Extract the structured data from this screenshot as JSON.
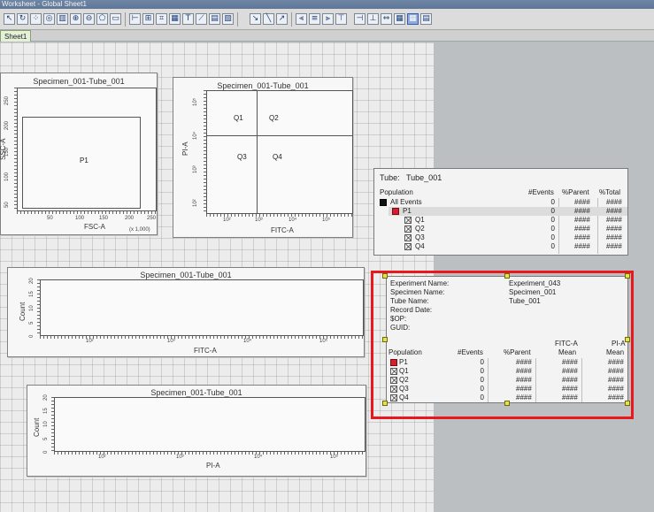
{
  "window": {
    "title": "Worksheet - Global Sheet1"
  },
  "tabs": [
    {
      "label": "Sheet1"
    }
  ],
  "panels": {
    "dot1": {
      "title": "Specimen_001-Tube_001",
      "xlabel": "FSC-A",
      "ylabel": "SSC-A",
      "x_ticks": [
        "50",
        "100",
        "150",
        "200",
        "250"
      ],
      "x_scale": "(x 1,000)",
      "y_ticks": [
        "50",
        "100",
        "150",
        "200",
        "250"
      ],
      "gate": "P1"
    },
    "dot2": {
      "title": "Specimen_001-Tube_001",
      "xlabel": "FITC-A",
      "ylabel": "PI-A",
      "x_ticks": [
        "10²",
        "10³",
        "10⁴",
        "10⁵"
      ],
      "y_ticks": [
        "10²",
        "10³",
        "10⁴",
        "10⁵"
      ],
      "quadrants": [
        "Q1",
        "Q2",
        "Q3",
        "Q4"
      ]
    },
    "hist1": {
      "title": "Specimen_001-Tube_001",
      "xlabel": "FITC-A",
      "ylabel": "Count",
      "x_ticks": [
        "10²",
        "10³",
        "10⁴",
        "10⁵"
      ],
      "y_ticks": [
        "0",
        "5",
        "10",
        "15",
        "20"
      ]
    },
    "hist2": {
      "title": "Specimen_001-Tube_001",
      "xlabel": "PI-A",
      "ylabel": "Count",
      "x_ticks": [
        "10²",
        "10³",
        "10⁴",
        "10⁵"
      ],
      "y_ticks": [
        "0",
        "5",
        "10",
        "15",
        "20"
      ]
    }
  },
  "hierarchy": {
    "tube_label": "Tube:",
    "tube_value": "Tube_001",
    "headers": {
      "population": "Population",
      "events": "#Events",
      "parent": "%Parent",
      "total": "%Total"
    },
    "rows": [
      {
        "name": "All Events",
        "events": "0",
        "parent": "####",
        "total": "####"
      },
      {
        "name": "P1",
        "events": "0",
        "parent": "####",
        "total": "####"
      },
      {
        "name": "Q1",
        "events": "0",
        "parent": "####",
        "total": "####"
      },
      {
        "name": "Q2",
        "events": "0",
        "parent": "####",
        "total": "####"
      },
      {
        "name": "Q3",
        "events": "0",
        "parent": "####",
        "total": "####"
      },
      {
        "name": "Q4",
        "events": "0",
        "parent": "####",
        "total": "####"
      }
    ]
  },
  "statistics": {
    "info": [
      {
        "label": "Experiment Name:",
        "value": "Experiment_043"
      },
      {
        "label": "Specimen Name:",
        "value": "Specimen_001"
      },
      {
        "label": "Tube Name:",
        "value": "Tube_001"
      },
      {
        "label": "Record Date:",
        "value": ""
      },
      {
        "label": "$OP:",
        "value": ""
      },
      {
        "label": "GUID:",
        "value": ""
      }
    ],
    "headers": {
      "population": "Population",
      "events": "#Events",
      "parent": "%Parent",
      "fitc_1": "FITC-A",
      "fitc_2": "Mean",
      "pi_1": "PI-A",
      "pi_2": "Mean"
    },
    "rows": [
      {
        "name": "P1",
        "events": "0",
        "parent": "####",
        "fitc": "####",
        "pi": "####"
      },
      {
        "name": "Q1",
        "events": "0",
        "parent": "####",
        "fitc": "####",
        "pi": "####"
      },
      {
        "name": "Q2",
        "events": "0",
        "parent": "####",
        "fitc": "####",
        "pi": "####"
      },
      {
        "name": "Q3",
        "events": "0",
        "parent": "####",
        "fitc": "####",
        "pi": "####"
      },
      {
        "name": "Q4",
        "events": "0",
        "parent": "####",
        "fitc": "####",
        "pi": "####"
      }
    ]
  },
  "colors": {
    "highlight": "#e8181c",
    "p1": "#d4202e",
    "all_events": "#111111",
    "selection_handle": "#e8e24a"
  },
  "toolbar_icons": [
    "pointer-icon",
    "rotate-icon",
    "dot-plot-icon",
    "contour-plot-icon",
    "histogram-icon",
    "zoom-in-icon",
    "zoom-out-icon",
    "polygon-gate-icon",
    "rectangle-gate-icon",
    "interval-gate-icon",
    "quadrant-gate-icon",
    "snap-gate-icon",
    "auto-gate-icon",
    "text-tool-icon",
    "line-tool-icon",
    "arrow-tool-icon",
    "align-left-icon",
    "align-center-icon",
    "align-right-icon",
    "align-top-icon",
    "align-middle-icon",
    "align-bottom-icon",
    "grid-icon",
    "show-grid-icon"
  ]
}
